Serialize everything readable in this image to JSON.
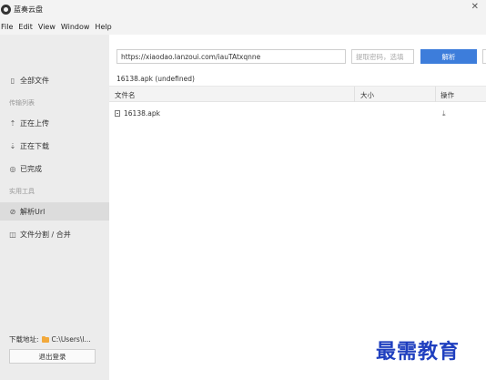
{
  "window": {
    "title": "蓝奏云盘",
    "close_glyph": "✕"
  },
  "menu": [
    "File",
    "Edit",
    "View",
    "Window",
    "Help"
  ],
  "sidebar": {
    "all_files": {
      "label": "全部文件",
      "icon": "file-icon"
    },
    "section_transfer": "传输列表",
    "uploading": {
      "label": "正在上传",
      "icon": "upload-icon"
    },
    "downloading": {
      "label": "正在下载",
      "icon": "download-icon"
    },
    "completed": {
      "label": "已完成",
      "icon": "check-circle-icon"
    },
    "section_tools": "实用工具",
    "parse_url": {
      "label": "解析Url",
      "icon": "link-icon"
    },
    "split_merge": {
      "label": "文件分割 / 合并",
      "icon": "split-icon"
    },
    "download_path_label": "下载地址:",
    "download_path_value": "C:\\Users\\l...",
    "logout_label": "退出登录"
  },
  "main": {
    "url_value": "https://xiaodao.lanzoui.com/iauTAtxqnne",
    "password_placeholder": "提取密码，选填",
    "parse_button": "解析",
    "file_info": "16138.apk  (undefined)",
    "columns": {
      "name": "文件名",
      "size": "大小",
      "action": "操作"
    },
    "rows": [
      {
        "name": "16138.apk",
        "size": "",
        "action_icon": "download-icon"
      }
    ]
  },
  "watermark": "最需教育",
  "colors": {
    "accent": "#3d7ddb",
    "sidebar_bg": "#ececec",
    "folder": "#f2a93b",
    "watermark": "#1f3fbf"
  }
}
